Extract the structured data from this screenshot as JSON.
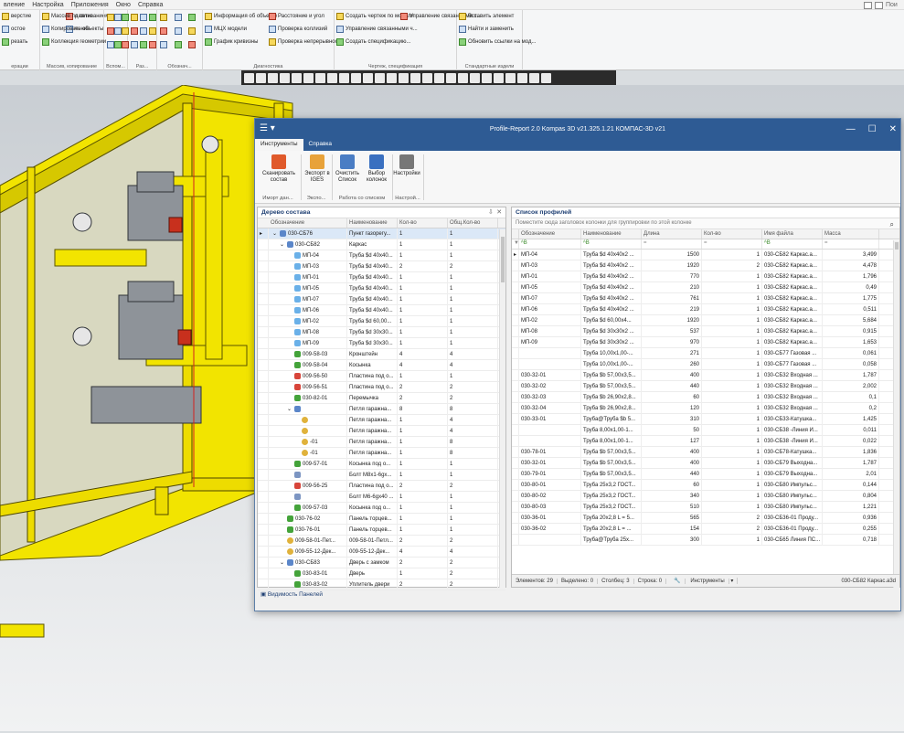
{
  "menu": [
    "вление",
    "Настройка",
    "Приложения",
    "Окно",
    "Справка"
  ],
  "search_hint": "Пои",
  "ribbon": {
    "groups": [
      {
        "label": "ерации",
        "items": [
          "верстие",
          "остое",
          "резать",
          "давливанием",
          "чение"
        ]
      },
      {
        "label": "Массив, копирование",
        "items": [
          "Массив по сетке",
          "Копировать объекты",
          "Коллекция геометрии"
        ]
      },
      {
        "label": "Вспом...",
        "items": []
      },
      {
        "label": "Раз...",
        "items": []
      },
      {
        "label": "Обознач...",
        "items": []
      },
      {
        "label": "Диагностика",
        "items": [
          "Информация об объекте",
          "МЦХ модели",
          "График кривизны",
          "Расстояние и угол",
          "Проверка коллизий",
          "Проверка непрерывности"
        ]
      },
      {
        "label": "Чертеж, спецификация",
        "items": [
          "Создать чертеж по модели",
          "Управление связанными ч...",
          "Создать спецификацию...",
          "Управление связанными с..."
        ]
      },
      {
        "label": "Стандартные издели",
        "items": [
          "Вставить элемент",
          "Найти и заменить",
          "Обновить ссылки на мод..."
        ]
      }
    ]
  },
  "dialog": {
    "title": "Profile-Report 2.0 Kompas 3D v21.325.1.21 КОМПАС-3D v21",
    "tabs": [
      "Инструменты",
      "Справка"
    ],
    "buttons": [
      {
        "label": "Сканировать состав",
        "color": "#e05a2b"
      },
      {
        "label": "Экспорт в IGES",
        "color": "#e8a23a"
      },
      {
        "label": "Очистить Список",
        "color": "#4a7dc4"
      },
      {
        "label": "Выбор колонок",
        "color": "#3a70c0"
      },
      {
        "label": "Настройки",
        "color": "#777777"
      }
    ],
    "groups": [
      "Иморт дан...",
      "Экспо...",
      "Работа со списком",
      "Настрой..."
    ],
    "tree_panel": {
      "title": "Дерево состава",
      "columns": [
        "Обозначение",
        "Наименование",
        "Кол-во",
        "Общ.Кол-во"
      ],
      "rows": [
        {
          "lvl": 0,
          "exp": "v",
          "icon": "asm",
          "name": "030-СБ76",
          "desc": "Пункт газорегу...",
          "qty": "1",
          "tot": "1",
          "sel": true
        },
        {
          "lvl": 1,
          "exp": "v",
          "icon": "asm",
          "name": "030-СБ82",
          "desc": "Каркас",
          "qty": "1",
          "tot": "1"
        },
        {
          "lvl": 2,
          "exp": "",
          "icon": "prt",
          "name": "МП-04",
          "desc": "Труба $d 40x40...",
          "qty": "1",
          "tot": "1"
        },
        {
          "lvl": 2,
          "exp": "",
          "icon": "prt",
          "name": "МП-03",
          "desc": "Труба $d 40x40...",
          "qty": "2",
          "tot": "2"
        },
        {
          "lvl": 2,
          "exp": "",
          "icon": "prt",
          "name": "МП-01",
          "desc": "Труба $d 40x40...",
          "qty": "1",
          "tot": "1"
        },
        {
          "lvl": 2,
          "exp": "",
          "icon": "prt",
          "name": "МП-05",
          "desc": "Труба $d 40x40...",
          "qty": "1",
          "tot": "1"
        },
        {
          "lvl": 2,
          "exp": "",
          "icon": "prt",
          "name": "МП-07",
          "desc": "Труба $d 40x40...",
          "qty": "1",
          "tot": "1"
        },
        {
          "lvl": 2,
          "exp": "",
          "icon": "prt",
          "name": "МП-06",
          "desc": "Труба $d 40x40...",
          "qty": "1",
          "tot": "1"
        },
        {
          "lvl": 2,
          "exp": "",
          "icon": "prt",
          "name": "МП-02",
          "desc": "Труба $d 60,00...",
          "qty": "1",
          "tot": "1"
        },
        {
          "lvl": 2,
          "exp": "",
          "icon": "prt",
          "name": "МП-08",
          "desc": "Труба $d 30x30...",
          "qty": "1",
          "tot": "1"
        },
        {
          "lvl": 2,
          "exp": "",
          "icon": "prt",
          "name": "МП-09",
          "desc": "Труба $d 30x30...",
          "qty": "1",
          "tot": "1"
        },
        {
          "lvl": 2,
          "exp": "",
          "icon": "grn",
          "name": "009-58-03",
          "desc": "Кронштейн",
          "qty": "4",
          "tot": "4"
        },
        {
          "lvl": 2,
          "exp": "",
          "icon": "grn",
          "name": "009-58-04",
          "desc": "Косынка",
          "qty": "4",
          "tot": "4"
        },
        {
          "lvl": 2,
          "exp": "",
          "icon": "red",
          "name": "009-56-50",
          "desc": "Пластина под о...",
          "qty": "1",
          "tot": "1"
        },
        {
          "lvl": 2,
          "exp": "",
          "icon": "red",
          "name": "009-56-51",
          "desc": "Пластина под о...",
          "qty": "2",
          "tot": "2"
        },
        {
          "lvl": 2,
          "exp": "",
          "icon": "grn",
          "name": "030-82-01",
          "desc": "Перемычка",
          "qty": "2",
          "tot": "2"
        },
        {
          "lvl": 2,
          "exp": "v",
          "icon": "asm",
          "name": "",
          "desc": "Петля гаражна...",
          "qty": "8",
          "tot": "8"
        },
        {
          "lvl": 3,
          "exp": "",
          "icon": "yel",
          "name": "",
          "desc": "Петля гаражна...",
          "qty": "1",
          "tot": "4"
        },
        {
          "lvl": 3,
          "exp": "",
          "icon": "yel",
          "name": "",
          "desc": "Петля гаражна...",
          "qty": "1",
          "tot": "4"
        },
        {
          "lvl": 3,
          "exp": "",
          "icon": "yel",
          "name": "-01",
          "desc": "Петля гаражна...",
          "qty": "1",
          "tot": "8"
        },
        {
          "lvl": 3,
          "exp": "",
          "icon": "yel",
          "name": "-01",
          "desc": "Петля гаражна...",
          "qty": "1",
          "tot": "8"
        },
        {
          "lvl": 2,
          "exp": "",
          "icon": "grn",
          "name": "009-57-01",
          "desc": "Косынка под о...",
          "qty": "1",
          "tot": "1"
        },
        {
          "lvl": 2,
          "exp": "",
          "icon": "bolt",
          "name": "",
          "desc": "Болт М8x1-6gx...",
          "qty": "1",
          "tot": "1"
        },
        {
          "lvl": 2,
          "exp": "",
          "icon": "red",
          "name": "009-56-25",
          "desc": "Пластина под о...",
          "qty": "2",
          "tot": "2"
        },
        {
          "lvl": 2,
          "exp": "",
          "icon": "bolt",
          "name": "",
          "desc": "Болт М6-6gx40 ...",
          "qty": "1",
          "tot": "1"
        },
        {
          "lvl": 2,
          "exp": "",
          "icon": "grn",
          "name": "009-57-03",
          "desc": "Косынка под о...",
          "qty": "1",
          "tot": "1"
        },
        {
          "lvl": 1,
          "exp": "",
          "icon": "grn",
          "name": "030-76-02",
          "desc": "Панель торцев...",
          "qty": "1",
          "tot": "1"
        },
        {
          "lvl": 1,
          "exp": "",
          "icon": "grn",
          "name": "030-76-01",
          "desc": "Панель торцев...",
          "qty": "1",
          "tot": "1"
        },
        {
          "lvl": 1,
          "exp": "",
          "icon": "yel",
          "name": "009-58-01-Пет...",
          "desc": "009-58-01-Петл...",
          "qty": "2",
          "tot": "2"
        },
        {
          "lvl": 1,
          "exp": "",
          "icon": "yel",
          "name": "009-55-12-Дек...",
          "desc": "009-55-12-Дек...",
          "qty": "4",
          "tot": "4"
        },
        {
          "lvl": 1,
          "exp": "v",
          "icon": "asm",
          "name": "030-СБ83",
          "desc": "Дверь с замком",
          "qty": "2",
          "tot": "2"
        },
        {
          "lvl": 2,
          "exp": "",
          "icon": "grn",
          "name": "030-83-01",
          "desc": "Дверь",
          "qty": "1",
          "tot": "2"
        },
        {
          "lvl": 2,
          "exp": "",
          "icon": "grn",
          "name": "030-83-02",
          "desc": "Уплитель двери",
          "qty": "2",
          "tot": "2"
        }
      ]
    },
    "list_panel": {
      "title": "Список профилей",
      "group_hint": "Поместите сюда заголовок колонки для группировки по этой колонке",
      "columns": [
        "Обозначение",
        "Наименование",
        "Длина",
        "Кол-во",
        "Имя файла",
        "Масса"
      ],
      "rows": [
        [
          "МП-04",
          "Труба $d 40x40x2 ...",
          "1500",
          "1",
          "030-СБ82 Каркас.а...",
          "3,499"
        ],
        [
          "МП-03",
          "Труба $d 40x40x2 ...",
          "1920",
          "2",
          "030-СБ82 Каркас.а...",
          "4,478"
        ],
        [
          "МП-01",
          "Труба $d 40x40x2 ...",
          "770",
          "1",
          "030-СБ82 Каркас.а...",
          "1,796"
        ],
        [
          "МП-05",
          "Труба $d 40x40x2 ...",
          "210",
          "1",
          "030-СБ82 Каркас.а...",
          "0,49"
        ],
        [
          "МП-07",
          "Труба $d 40x40x2 ...",
          "761",
          "1",
          "030-СБ82 Каркас.а...",
          "1,775"
        ],
        [
          "МП-06",
          "Труба $d 40x40x2 ...",
          "219",
          "1",
          "030-СБ82 Каркас.а...",
          "0,511"
        ],
        [
          "МП-02",
          "Труба $d 60,00x4...",
          "1920",
          "1",
          "030-СБ82 Каркас.а...",
          "5,684"
        ],
        [
          "МП-08",
          "Труба $d 30x30x2 ...",
          "537",
          "1",
          "030-СБ82 Каркас.а...",
          "0,915"
        ],
        [
          "МП-09",
          "Труба $d 30x30x2 ...",
          "970",
          "1",
          "030-СБ82 Каркас.а...",
          "1,653"
        ],
        [
          "",
          "Труба 10,00x1,00-...",
          "271",
          "1",
          "030-СБ77 Газовая ...",
          "0,061"
        ],
        [
          "",
          "Труба 10,00x1,00-...",
          "260",
          "1",
          "030-СБ77 Газовая ...",
          "0,058"
        ],
        [
          "030-32-01",
          "Труба $b 57,00x3,5...",
          "400",
          "1",
          "030-СБ32 Входная ...",
          "1,787"
        ],
        [
          "030-32-02",
          "Труба $b 57,00x3,5...",
          "440",
          "1",
          "030-СБ32 Входная ...",
          "2,002"
        ],
        [
          "030-32-03",
          "Труба $b 26,90x2,8...",
          "60",
          "1",
          "030-СБ32 Входная ...",
          "0,1"
        ],
        [
          "030-32-04",
          "Труба $b 26,90x2,8...",
          "120",
          "1",
          "030-СБ32 Входная ...",
          "0,2"
        ],
        [
          "030-33-01",
          "Труба@Труба $b 5...",
          "310",
          "1",
          "030-СБ33-Катушка...",
          "1,425"
        ],
        [
          "",
          "Труба 8,00x1,00-1...",
          "50",
          "1",
          "030-СБ38 -Линия И...",
          "0,011"
        ],
        [
          "",
          "Труба 8,00x1,00-1...",
          "127",
          "1",
          "030-СБ38 -Линия И...",
          "0,022"
        ],
        [
          "030-78-01",
          "Труба $b 57,00x3,5...",
          "400",
          "1",
          "030-СБ78-Катушка...",
          "1,836"
        ],
        [
          "030-32-01",
          "Труба $b 57,00x3,5...",
          "400",
          "1",
          "030-СБ79 Выходна...",
          "1,787"
        ],
        [
          "030-79-01",
          "Труба $b 57,00x3,5...",
          "440",
          "1",
          "030-СБ79 Выходна...",
          "2,01"
        ],
        [
          "030-80-01",
          "Труба 25x3,2 ГОСТ...",
          "60",
          "1",
          "030-СБ80 Импульс...",
          "0,144"
        ],
        [
          "030-80-02",
          "Труба 25x3,2 ГОСТ...",
          "340",
          "1",
          "030-СБ80 Импульс...",
          "0,804"
        ],
        [
          "030-80-03",
          "Труба 25x3,2 ГОСТ...",
          "510",
          "1",
          "030-СБ80 Импульс...",
          "1,221"
        ],
        [
          "030-36-01",
          "Труба 20x2,8 L = 5...",
          "565",
          "2",
          "030-СБ36-01 Проду...",
          "0,936"
        ],
        [
          "030-36-02",
          "Труба 20x2,8 L = ...",
          "154",
          "2",
          "030-СБ36-01 Проду...",
          "0,255"
        ],
        [
          "",
          "Труба@Труба 25x...",
          "300",
          "1",
          "030-СБ65 Линия ПС...",
          "0,718"
        ]
      ]
    },
    "status": {
      "elements": "Элементов:  29",
      "selected": "Выделено:  0",
      "columns": "Столбец:  3",
      "row": "Строка:  0",
      "tools": "Инструменты",
      "file": "030-СБ82 Каркас.а3d"
    },
    "panel_visibility": "Видимость Панелей"
  }
}
